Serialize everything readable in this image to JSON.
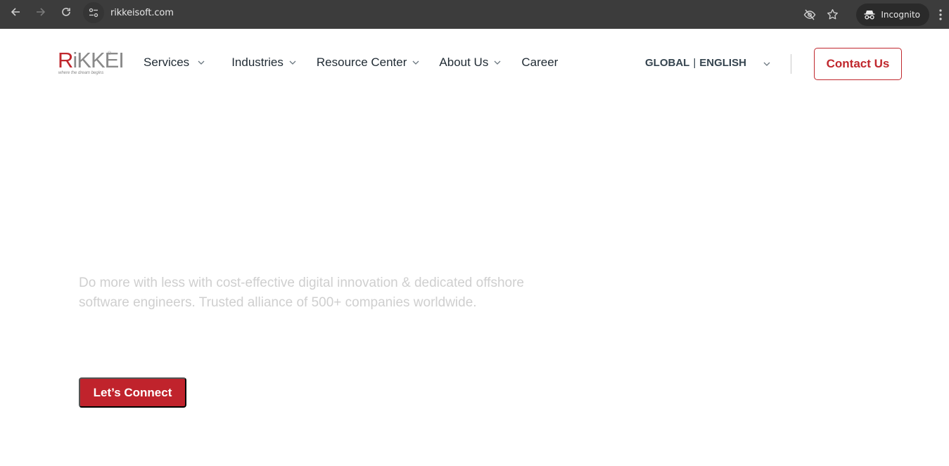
{
  "browser": {
    "url": "rikkeisoft.com",
    "incognito_label": "Incognito",
    "icons": {
      "back": "arrow-left-icon",
      "forward": "arrow-right-icon",
      "reload": "reload-icon",
      "site_info": "tune-icon",
      "tracking": "eye-off-icon",
      "bookmark": "star-icon",
      "incognito": "incognito-icon",
      "menu": "kebab-menu-icon"
    }
  },
  "header": {
    "logo": {
      "letter_accent": "R",
      "letters_rest": "iKKEI",
      "registered": "®",
      "tagline": "where the dream begins"
    },
    "nav": [
      {
        "label": "Services",
        "has_dropdown": true
      },
      {
        "label": "Industries",
        "has_dropdown": true
      },
      {
        "label": "Resource Center",
        "has_dropdown": true
      },
      {
        "label": "About Us",
        "has_dropdown": true
      },
      {
        "label": "Career",
        "has_dropdown": false
      }
    ],
    "language": {
      "region": "GLOBAL",
      "separator": "|",
      "language": "ENGLISH"
    },
    "contact_label": "Contact Us"
  },
  "hero": {
    "description": "Do more with less with cost-effective digital innovation & dedicated offshore software engineers. Trusted alliance of 500+ companies worldwide.",
    "cta_label": "Let’s Connect"
  },
  "colors": {
    "brand_red": "#c0272d",
    "chrome_bg": "#3c3c3c",
    "nav_text": "#1f2a33",
    "hero_text_faded": "#cfcfcf"
  }
}
